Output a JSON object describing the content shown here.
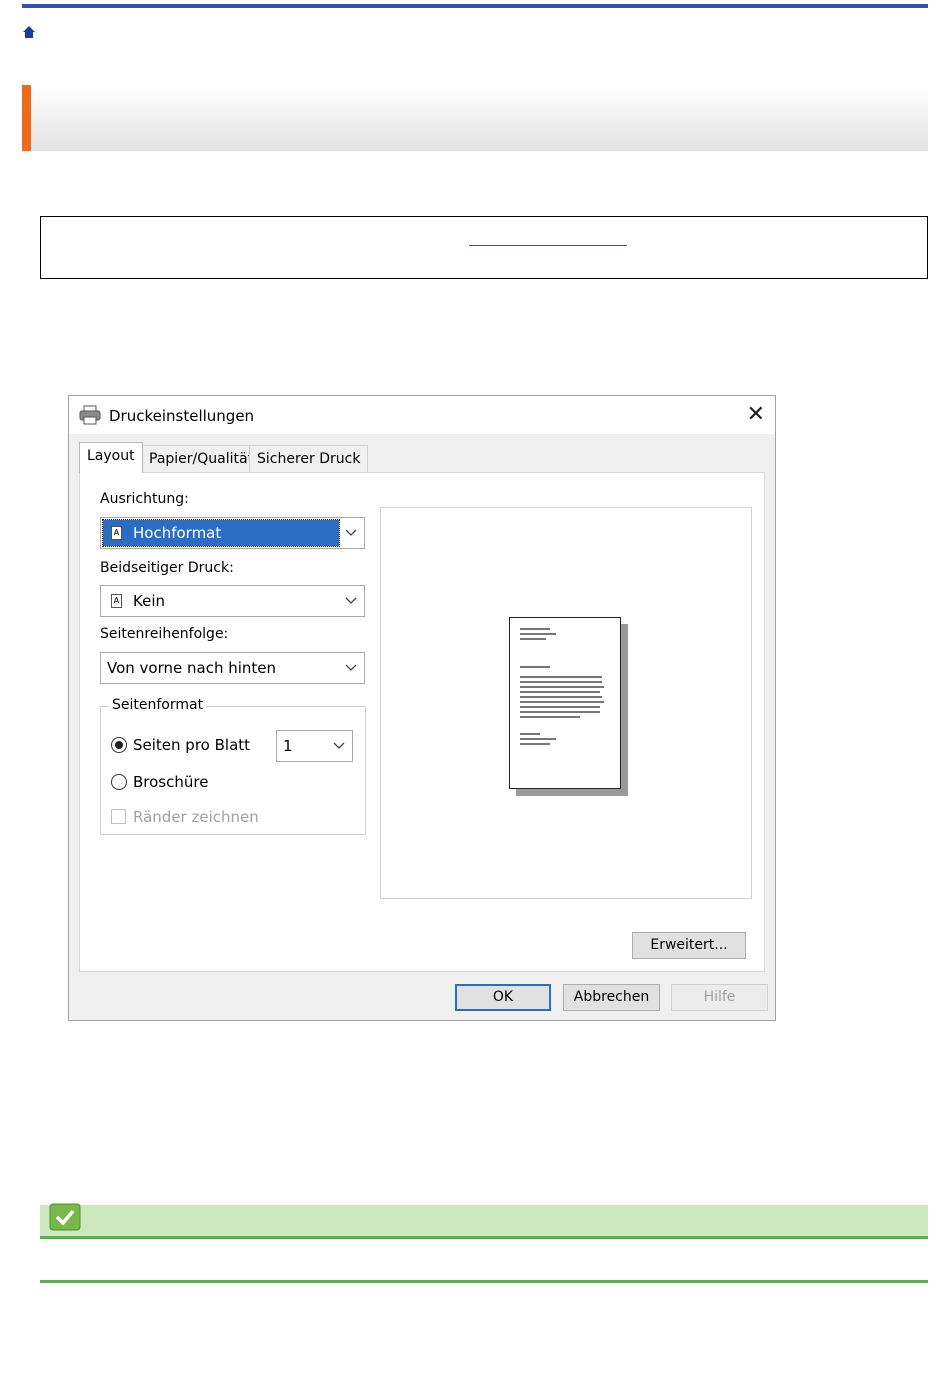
{
  "dialog": {
    "title": "Druckeinstellungen",
    "tabs": [
      "Layout",
      "Papier/Qualität",
      "Sicherer Druck"
    ],
    "orientation": {
      "label": "Ausrichtung:",
      "value": "Hochformat"
    },
    "duplex": {
      "label": "Beidseitiger Druck:",
      "value": "Kein"
    },
    "page_order": {
      "label": "Seitenreihenfolge:",
      "value": "Von vorne nach hinten"
    },
    "page_format": {
      "title": "Seitenformat",
      "pages_per_sheet": {
        "label": "Seiten pro Blatt",
        "value": "1",
        "selected": true
      },
      "booklet": {
        "label": "Broschüre",
        "selected": false
      },
      "draw_borders": {
        "label": "Ränder zeichnen",
        "checked": false,
        "enabled": false
      }
    },
    "advanced_button": "Erweitert...",
    "buttons": {
      "ok": "OK",
      "cancel": "Abbrechen",
      "help": "Hilfe"
    }
  },
  "colors": {
    "accent": "#ee6a19",
    "topbar": "#3a4fb5",
    "success": "#58b14b",
    "selection": "#2b6dc2"
  }
}
